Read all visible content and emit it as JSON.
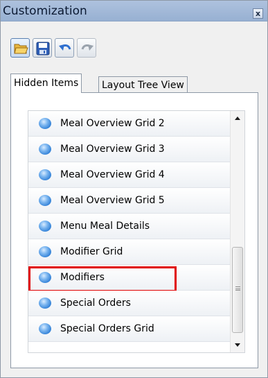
{
  "window": {
    "title": "Customization",
    "close_icon": "close-icon",
    "close_glyph": "x"
  },
  "toolbar": {
    "buttons": [
      {
        "name": "open-button",
        "icon": "folder-open-icon",
        "enabled": true,
        "highlighted": true
      },
      {
        "name": "save-button",
        "icon": "save-icon",
        "enabled": true
      },
      {
        "name": "undo-button",
        "icon": "undo-icon",
        "enabled": true
      },
      {
        "name": "redo-button",
        "icon": "redo-icon",
        "enabled": false
      }
    ]
  },
  "tabs": [
    {
      "label": "Hidden Items",
      "active": true
    },
    {
      "label": "Layout Tree View",
      "active": false
    }
  ],
  "hidden_items": {
    "items": [
      {
        "label": "Meal Overview Grid 2",
        "icon": "blue-bullet-icon"
      },
      {
        "label": "Meal Overview Grid 3",
        "icon": "blue-bullet-icon"
      },
      {
        "label": "Meal Overview Grid 4",
        "icon": "blue-bullet-icon"
      },
      {
        "label": "Meal Overview Grid 5",
        "icon": "blue-bullet-icon"
      },
      {
        "label": "Menu Meal Details",
        "icon": "blue-bullet-icon"
      },
      {
        "label": "Modifier Grid",
        "icon": "blue-bullet-icon"
      },
      {
        "label": "Modifiers",
        "icon": "blue-bullet-icon",
        "highlighted": true
      },
      {
        "label": "Special Orders",
        "icon": "blue-bullet-icon"
      },
      {
        "label": "Special Orders Grid",
        "icon": "blue-bullet-icon"
      }
    ],
    "highlight_color": "#e00000"
  },
  "colors": {
    "titlebar": "#aec2de",
    "bullet": "#2f7fd6",
    "window_bg": "#f0f0f0"
  }
}
